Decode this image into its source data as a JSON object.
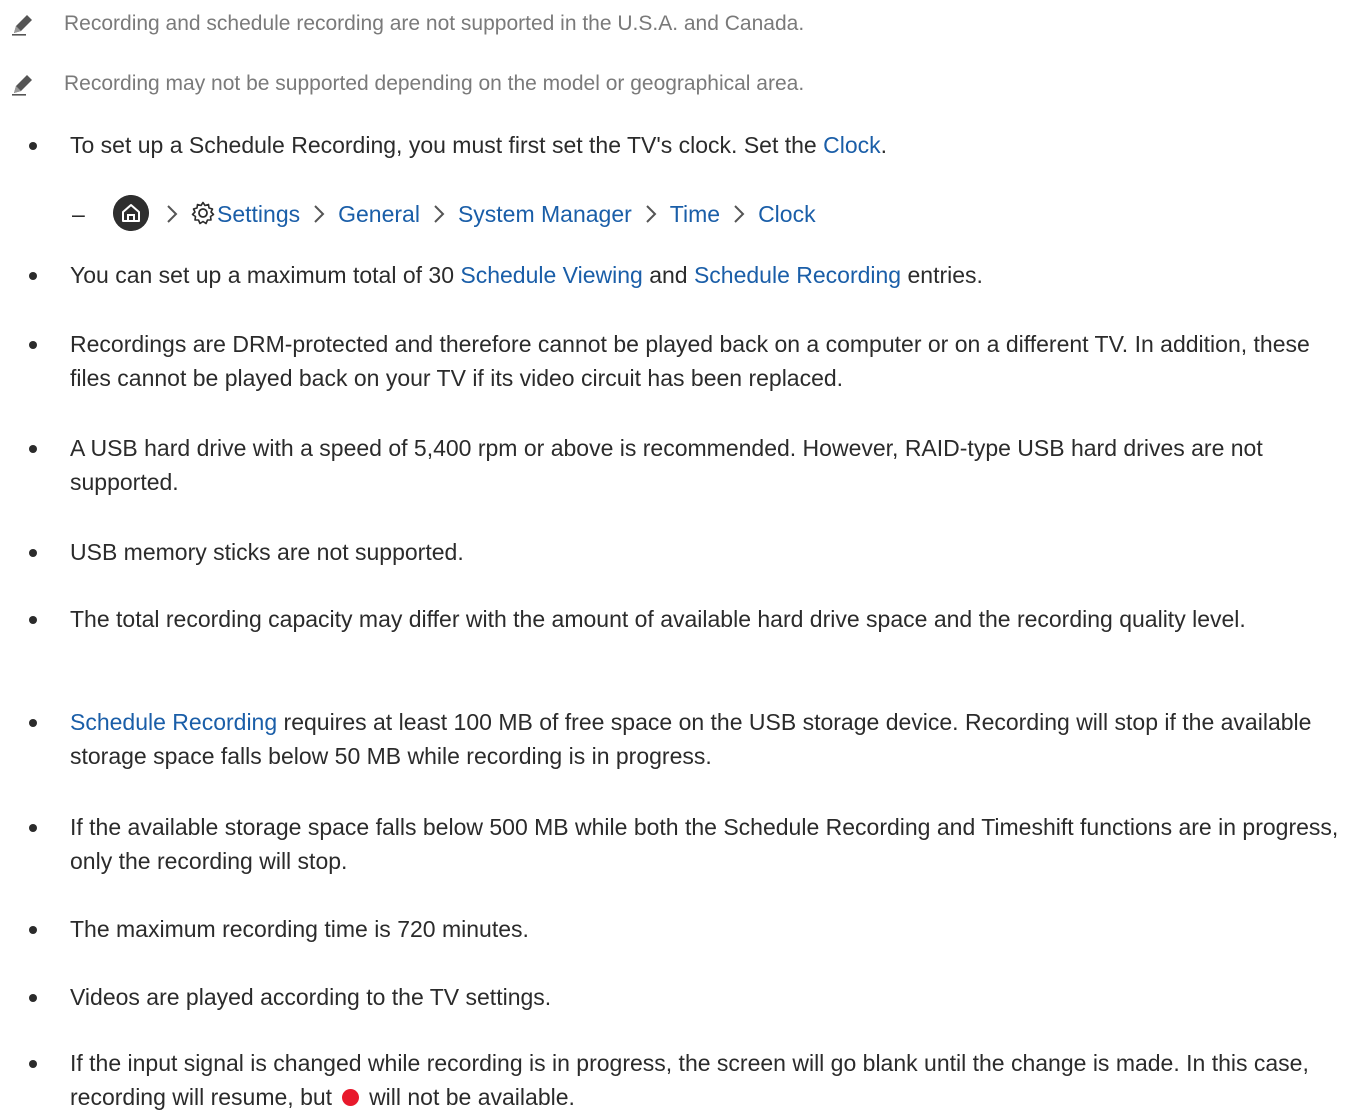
{
  "notes": [
    "Recording and schedule recording are not supported in the U.S.A. and Canada.",
    "Recording may not be supported depending on the model or geographical area."
  ],
  "clock_item": {
    "text": "To set up a Schedule Recording, you must first set the TV's clock. Set the ",
    "link": "Clock",
    "end": "."
  },
  "menu_path": {
    "dash": "–",
    "home_icon": "home-icon",
    "settings_icon": "gear-icon",
    "items": [
      "Settings",
      "General",
      "System Manager",
      "Time",
      "Clock"
    ]
  },
  "entries_item": {
    "pre": "You can set up a maximum total of 30 ",
    "link1": "Schedule Viewing",
    "mid": " and ",
    "link2": "Schedule Recording",
    "post": " entries."
  },
  "bullets": [
    "Recordings are DRM-protected and therefore cannot be played back on a computer or on a different TV. In addition, these files cannot be played back on your TV if its video circuit has been replaced.",
    "A USB hard drive with a speed of 5,400 rpm or above is recommended. However, RAID-type USB hard drives are not supported.",
    "USB memory sticks are not supported.",
    "The total recording capacity may differ with the amount of available hard drive space and the recording quality level."
  ],
  "space_item": {
    "link": "Schedule Recording",
    "text": " requires at least 100 MB of free space on the USB storage device. Recording will stop if the available storage space falls below 50 MB while recording is in progress."
  },
  "bullets2": [
    "If the available storage space falls below 500 MB while both the Schedule Recording and Timeshift functions are in progress, only the recording will stop.",
    "The maximum recording time is 720 minutes.",
    "Videos are played according to the TV settings."
  ],
  "signal_item": {
    "text": "If the input signal is changed while recording is in progress, the screen will go blank until the change is made. In this case, recording will resume, but",
    "icon": "record-button-icon",
    "end": "will not be available."
  },
  "colors": {
    "link": "#1a5ea8",
    "note": "#7a7a7a",
    "record": "#e8192c"
  }
}
